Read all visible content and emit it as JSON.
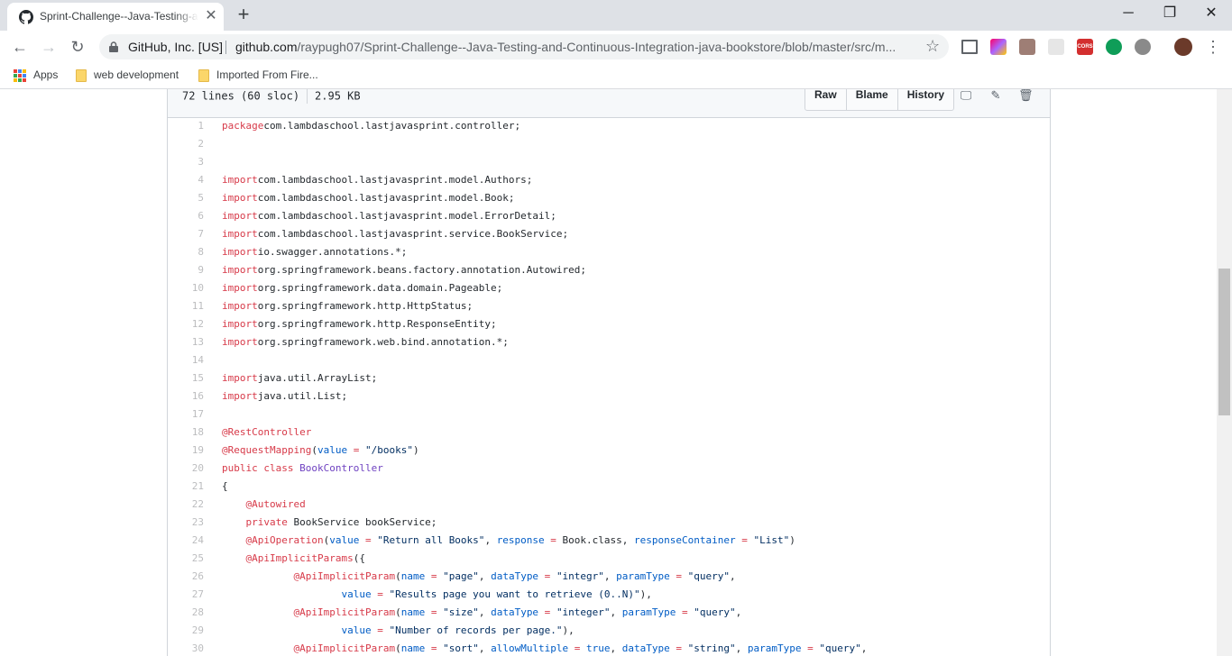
{
  "browser": {
    "tab": {
      "title": "Sprint-Challenge--Java-Testing-and-Continuous-Integration-java-bookstore"
    },
    "omnibox": {
      "site_name": "GitHub, Inc. [US]",
      "url_host": "github.com",
      "url_path": "/raypugh07/Sprint-Challenge--Java-Testing-and-Continuous-Integration-java-bookstore/blob/master/src/m..."
    },
    "bookmarks": [
      {
        "label": "Apps",
        "icon": "apps-grid-icon"
      },
      {
        "label": "web development",
        "icon": "folder-icon"
      },
      {
        "label": "Imported From Fire...",
        "icon": "folder-icon"
      }
    ],
    "extensions": [
      "screenshot-icon",
      "color-picker-icon",
      "pdf-icon",
      "puzzle-icon",
      "cors-icon",
      "hangouts-icon",
      "bug-icon"
    ],
    "accent_colors": {
      "tabstrip": "#dee1e6",
      "omnibox": "#f1f3f4",
      "scrollbar_thumb": "#c1c1c1"
    }
  },
  "file": {
    "lines_info": "72 lines (60 sloc)",
    "size": "2.95 KB",
    "buttons": {
      "raw": "Raw",
      "blame": "Blame",
      "history": "History"
    },
    "icons": [
      "desktop-icon",
      "pencil-icon",
      "trash-icon"
    ],
    "code": [
      [
        [
          "k",
          "package"
        ],
        [
          "",
          "com.lambdaschool.lastjavasprint.controller;"
        ]
      ],
      [],
      [],
      [
        [
          "k",
          "import"
        ],
        [
          "",
          "com.lambdaschool.lastjavasprint.model.Authors;"
        ]
      ],
      [
        [
          "k",
          "import"
        ],
        [
          "",
          "com.lambdaschool.lastjavasprint.model.Book;"
        ]
      ],
      [
        [
          "k",
          "import"
        ],
        [
          "",
          "com.lambdaschool.lastjavasprint.model.ErrorDetail;"
        ]
      ],
      [
        [
          "k",
          "import"
        ],
        [
          "",
          "com.lambdaschool.lastjavasprint.service.BookService;"
        ]
      ],
      [
        [
          "k",
          "import"
        ],
        [
          "",
          "io.swagger.annotations.*;"
        ]
      ],
      [
        [
          "k",
          "import"
        ],
        [
          "",
          "org.springframework.beans.factory.annotation.Autowired;"
        ]
      ],
      [
        [
          "k",
          "import"
        ],
        [
          "",
          "org.springframework.data.domain.Pageable;"
        ]
      ],
      [
        [
          "k",
          "import"
        ],
        [
          "",
          "org.springframework.http.HttpStatus;"
        ]
      ],
      [
        [
          "k",
          "import"
        ],
        [
          "",
          "org.springframework.http.ResponseEntity;"
        ]
      ],
      [
        [
          "k",
          "import"
        ],
        [
          "",
          "org.springframework.web.bind.annotation.*;"
        ]
      ],
      [],
      [
        [
          "k",
          "import"
        ],
        [
          "",
          "java.util.ArrayList;"
        ]
      ],
      [
        [
          "k",
          "import"
        ],
        [
          "",
          "java.util.List;"
        ]
      ],
      [],
      [
        [
          "a",
          "@RestController"
        ]
      ],
      [
        [
          "a",
          "@RequestMapping"
        ],
        [
          "",
          "("
        ],
        [
          "p",
          "value"
        ],
        [
          "",
          ""
        ],
        [
          "k",
          " = "
        ],
        [
          "s",
          "\"/books\""
        ],
        [
          "",
          ")"
        ]
      ],
      [
        [
          "k",
          "public"
        ],
        [
          "",
          " "
        ],
        [
          "k",
          "class"
        ],
        [
          "",
          " "
        ],
        [
          "t",
          "BookController"
        ]
      ],
      [
        [
          "",
          "{"
        ]
      ],
      [
        [
          "",
          "    "
        ],
        [
          "a",
          "@Autowired"
        ]
      ],
      [
        [
          "",
          "    "
        ],
        [
          "k",
          "private"
        ],
        [
          "",
          " BookService bookService;"
        ]
      ],
      [
        [
          "",
          "    "
        ],
        [
          "a",
          "@ApiOperation"
        ],
        [
          "",
          "("
        ],
        [
          "p",
          "value"
        ],
        [
          "k",
          " = "
        ],
        [
          "s",
          "\"Return all Books\""
        ],
        [
          "",
          ", "
        ],
        [
          "p",
          "response"
        ],
        [
          "k",
          " = "
        ],
        [
          "",
          "Book.class, "
        ],
        [
          "p",
          "responseContainer"
        ],
        [
          "k",
          " = "
        ],
        [
          "s",
          "\"List\""
        ],
        [
          "",
          ")"
        ]
      ],
      [
        [
          "",
          "    "
        ],
        [
          "a",
          "@ApiImplicitParams"
        ],
        [
          "",
          "({"
        ]
      ],
      [
        [
          "",
          "            "
        ],
        [
          "a",
          "@ApiImplicitParam"
        ],
        [
          "",
          "("
        ],
        [
          "p",
          "name"
        ],
        [
          "k",
          " = "
        ],
        [
          "s",
          "\"page\""
        ],
        [
          "",
          ", "
        ],
        [
          "p",
          "dataType"
        ],
        [
          "k",
          " = "
        ],
        [
          "s",
          "\"integr\""
        ],
        [
          "",
          ", "
        ],
        [
          "p",
          "paramType"
        ],
        [
          "k",
          " = "
        ],
        [
          "s",
          "\"query\""
        ],
        [
          "",
          ","
        ]
      ],
      [
        [
          "",
          "                    "
        ],
        [
          "p",
          "value"
        ],
        [
          "k",
          " = "
        ],
        [
          "s",
          "\"Results page you want to retrieve (0..N)\""
        ],
        [
          "",
          "),"
        ]
      ],
      [
        [
          "",
          "            "
        ],
        [
          "a",
          "@ApiImplicitParam"
        ],
        [
          "",
          "("
        ],
        [
          "p",
          "name"
        ],
        [
          "k",
          " = "
        ],
        [
          "s",
          "\"size\""
        ],
        [
          "",
          ", "
        ],
        [
          "p",
          "dataType"
        ],
        [
          "k",
          " = "
        ],
        [
          "s",
          "\"integer\""
        ],
        [
          "",
          ", "
        ],
        [
          "p",
          "paramType"
        ],
        [
          "k",
          " = "
        ],
        [
          "s",
          "\"query\""
        ],
        [
          "",
          ","
        ]
      ],
      [
        [
          "",
          "                    "
        ],
        [
          "p",
          "value"
        ],
        [
          "k",
          " = "
        ],
        [
          "s",
          "\"Number of records per page.\""
        ],
        [
          "",
          "),"
        ]
      ],
      [
        [
          "",
          "            "
        ],
        [
          "a",
          "@ApiImplicitParam"
        ],
        [
          "",
          "("
        ],
        [
          "p",
          "name"
        ],
        [
          "k",
          " = "
        ],
        [
          "s",
          "\"sort\""
        ],
        [
          "",
          ", "
        ],
        [
          "p",
          "allowMultiple"
        ],
        [
          "k",
          " = "
        ],
        [
          "p",
          "true"
        ],
        [
          "",
          ", "
        ],
        [
          "p",
          "dataType"
        ],
        [
          "k",
          " = "
        ],
        [
          "s",
          "\"string\""
        ],
        [
          "",
          ", "
        ],
        [
          "p",
          "paramType"
        ],
        [
          "k",
          " = "
        ],
        [
          "s",
          "\"query\""
        ],
        [
          "",
          ","
        ]
      ]
    ]
  }
}
